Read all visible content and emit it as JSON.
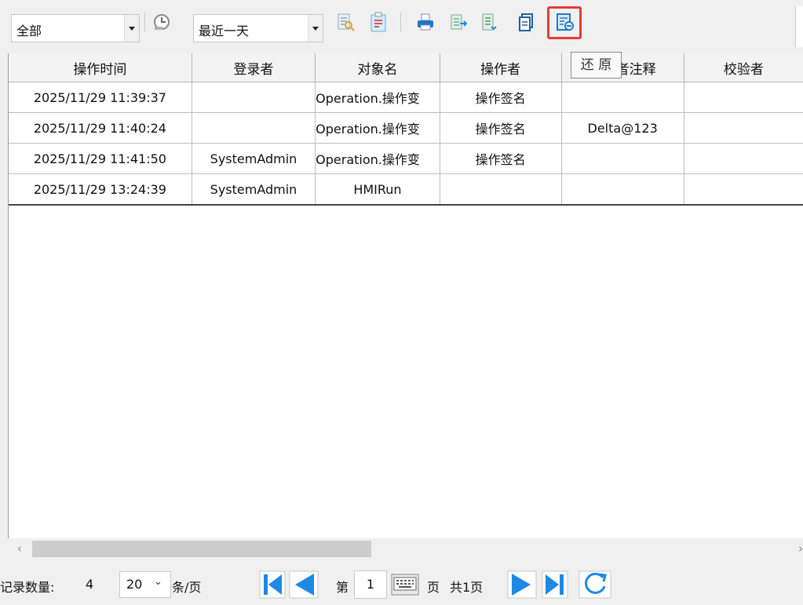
{
  "toolbar": {
    "filter_scope": "全部",
    "time_range": "最近一天",
    "tooltip": "还 原"
  },
  "table": {
    "columns": [
      "操作时间",
      "登录者",
      "对象名",
      "操作者",
      "操作者注释",
      "校验者"
    ],
    "rows": [
      [
        "2025/11/29 11:39:37",
        "",
        "Operation.操作变",
        "操作签名",
        "",
        ""
      ],
      [
        "2025/11/29 11:40:24",
        "",
        "Operation.操作变",
        "操作签名",
        "Delta@123",
        ""
      ],
      [
        "2025/11/29 11:41:50",
        "SystemAdmin",
        "Operation.操作变",
        "操作签名",
        "",
        ""
      ],
      [
        "2025/11/29 13:24:39",
        "SystemAdmin",
        "HMIRun",
        "",
        "",
        ""
      ]
    ]
  },
  "pager": {
    "record_count_label": "记录数量:",
    "record_count": "4",
    "page_size": "20",
    "per_page_label": "条/页",
    "page_prefix": "第",
    "current_page": "1",
    "page_suffix": "页",
    "total_pages": "共1页"
  },
  "colors": {
    "accent_blue": "#1e88e5",
    "highlight_red": "#e83a3a"
  }
}
